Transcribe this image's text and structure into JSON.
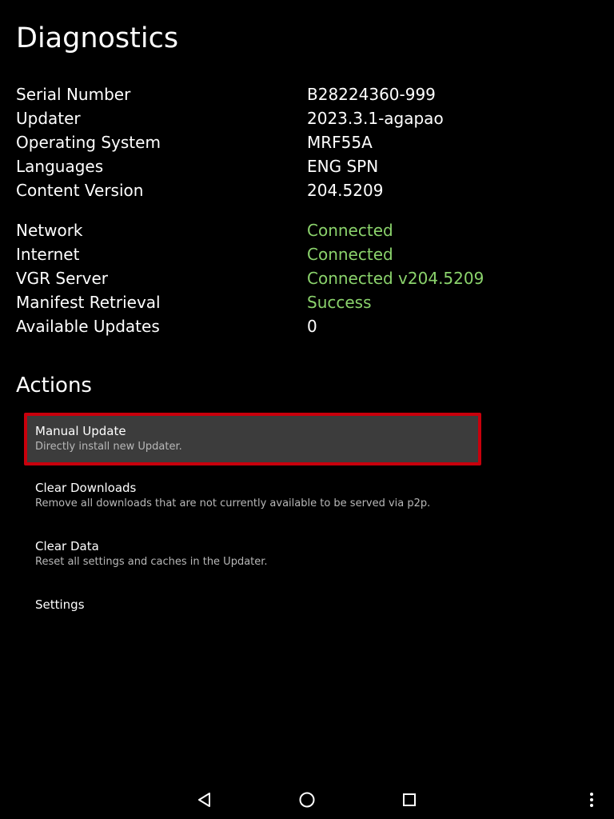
{
  "page": {
    "title": "Diagnostics"
  },
  "device_info": [
    {
      "label": "Serial Number",
      "value": "B28224360-999"
    },
    {
      "label": "Updater",
      "value": "2023.3.1-agapao"
    },
    {
      "label": "Operating System",
      "value": "MRF55A"
    },
    {
      "label": "Languages",
      "value": "ENG SPN"
    },
    {
      "label": "Content Version",
      "value": "204.5209"
    }
  ],
  "status_info": [
    {
      "label": "Network",
      "value": "Connected",
      "status": "ok"
    },
    {
      "label": "Internet",
      "value": "Connected",
      "status": "ok"
    },
    {
      "label": "VGR Server",
      "value": "Connected v204.5209",
      "status": "ok"
    },
    {
      "label": "Manifest Retrieval",
      "value": "Success",
      "status": "ok"
    },
    {
      "label": "Available Updates",
      "value": "0",
      "status": "neutral"
    }
  ],
  "actions": {
    "title": "Actions",
    "items": [
      {
        "title": "Manual Update",
        "description": "Directly install new Updater.",
        "selected": true
      },
      {
        "title": "Clear Downloads",
        "description": "Remove all downloads that are not currently available to be served via p2p.",
        "selected": false
      },
      {
        "title": "Clear Data",
        "description": "Reset all settings and caches in the Updater.",
        "selected": false
      },
      {
        "title": "Settings",
        "description": "",
        "selected": false
      }
    ]
  },
  "colors": {
    "background": "#000000",
    "status_ok": "#8bd36c",
    "selection_border": "#c8000c",
    "selection_fill": "#3c3c3c"
  },
  "navbar": {
    "icons": [
      "back-icon",
      "home-icon",
      "recents-icon",
      "more-vert-icon"
    ]
  }
}
